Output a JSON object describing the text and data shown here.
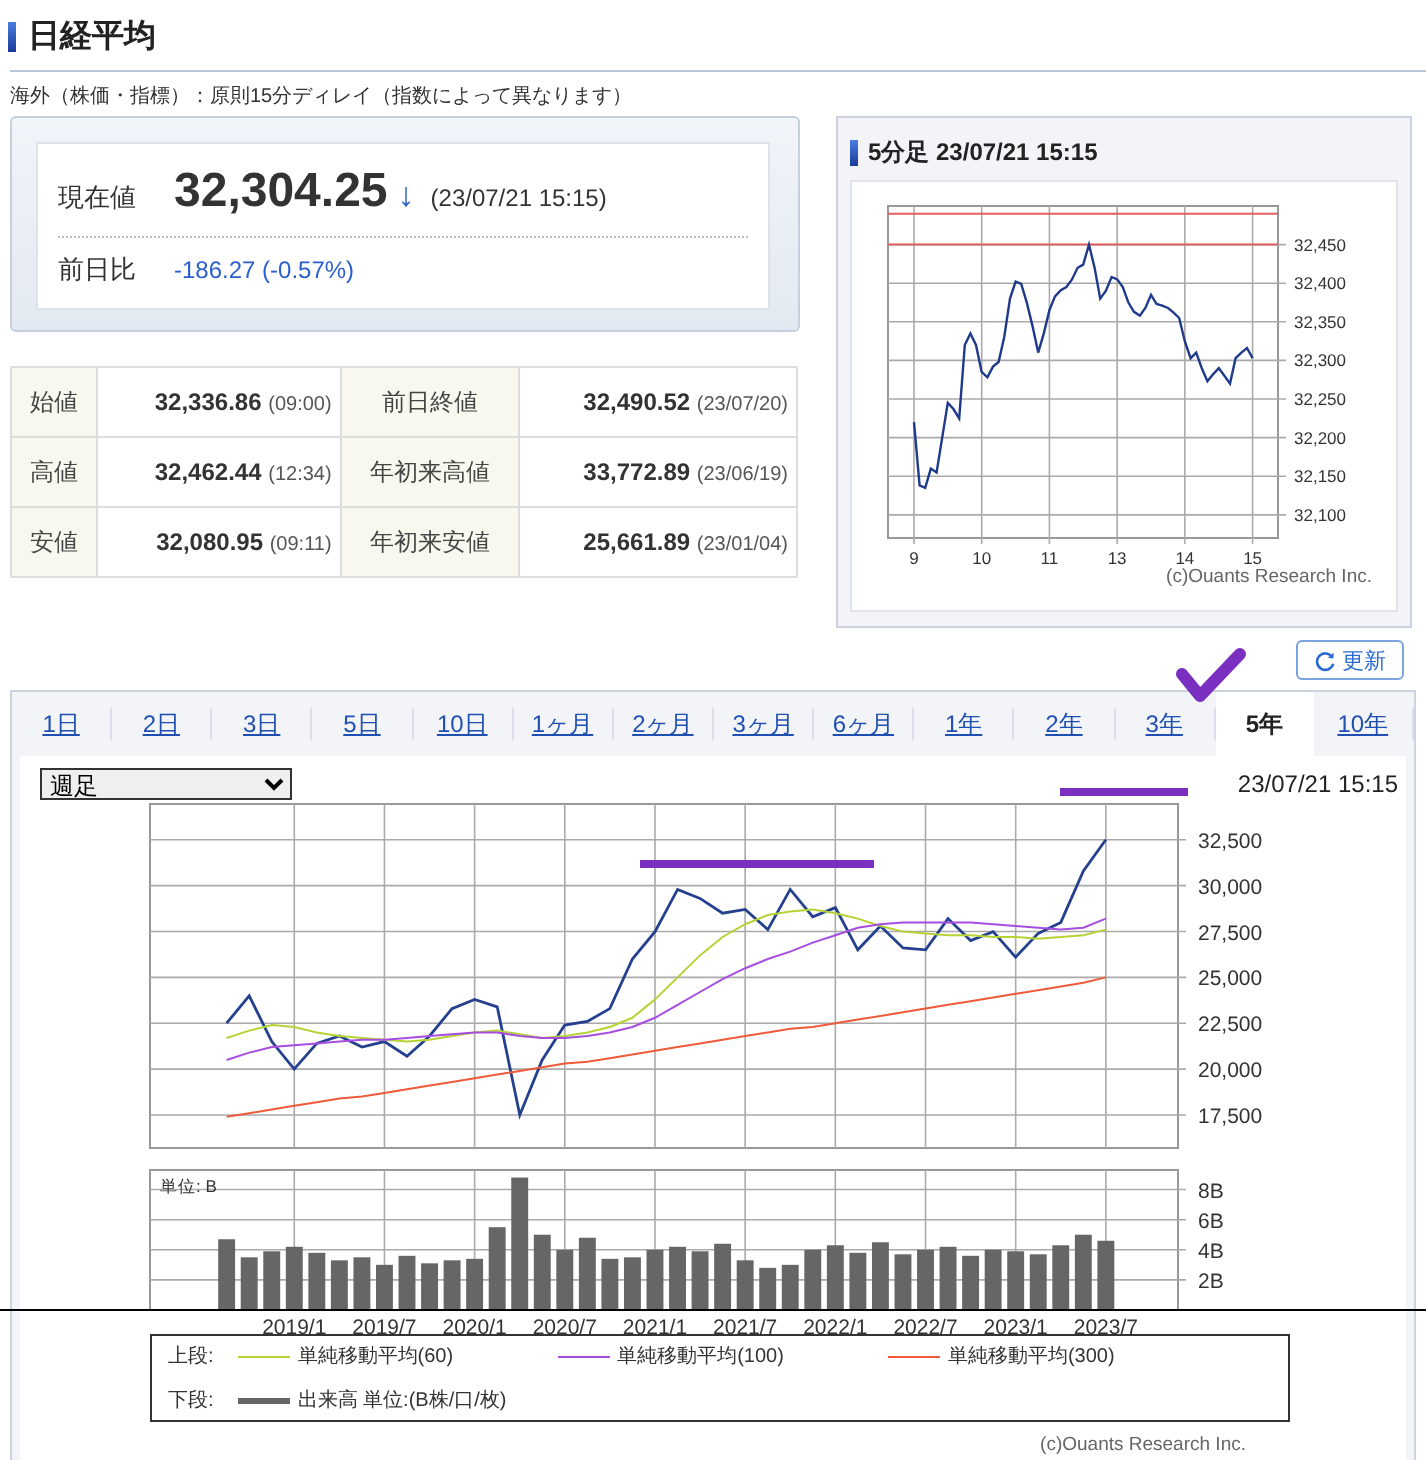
{
  "page_title": "日経平均",
  "note": "海外（株価・指標）：原則15分ディレイ（指数によって異なります）",
  "current": {
    "label": "現在値",
    "value": "32,304.25",
    "arrow": "↓",
    "time": "(23/07/21 15:15)",
    "change_label": "前日比",
    "change": "-186.27 (-0.57%)"
  },
  "stats": [
    {
      "cells": [
        {
          "label": "始値",
          "value": "32,336.86",
          "time": "(09:00)"
        },
        {
          "label": "前日終値",
          "value": "32,490.52",
          "time": "(23/07/20)"
        }
      ]
    },
    {
      "cells": [
        {
          "label": "高値",
          "value": "32,462.44",
          "time": "(12:34)"
        },
        {
          "label": "年初来高値",
          "value": "33,772.89",
          "time": "(23/06/19)"
        }
      ]
    },
    {
      "cells": [
        {
          "label": "安値",
          "value": "32,080.95",
          "time": "(09:11)"
        },
        {
          "label": "年初来安値",
          "value": "25,661.89",
          "time": "(23/01/04)"
        }
      ]
    }
  ],
  "intraday": {
    "title": "5分足 23/07/21 15:15",
    "credit": "(c)Ouants Research Inc.",
    "chart_data": {
      "type": "line",
      "categories": [
        "9",
        null,
        null,
        null,
        null,
        null,
        null,
        null,
        null,
        null,
        null,
        null,
        "10",
        null,
        null,
        null,
        null,
        null,
        null,
        null,
        null,
        null,
        null,
        null,
        "11",
        null,
        null,
        null,
        null,
        null,
        null,
        null,
        null,
        null,
        null,
        null,
        "13",
        null,
        null,
        null,
        null,
        null,
        null,
        null,
        null,
        null,
        null,
        null,
        "14",
        null,
        null,
        null,
        null,
        null,
        null,
        null,
        null,
        null,
        null,
        null,
        "15"
      ],
      "series": [
        {
          "color": "#1f3a8a",
          "values": [
            32220,
            32138,
            32135,
            32160,
            32155,
            32200,
            32245,
            32237,
            32225,
            32320,
            32335,
            32320,
            32285,
            32278,
            32292,
            32298,
            32330,
            32380,
            32402,
            32399,
            32375,
            32345,
            32310,
            32335,
            32365,
            32383,
            32391,
            32395,
            32405,
            32420,
            32424,
            32450,
            32420,
            32380,
            32390,
            32408,
            32405,
            32395,
            32375,
            32363,
            32358,
            32368,
            32385,
            32373,
            32371,
            32368,
            32362,
            32355,
            32325,
            32303,
            32310,
            32290,
            32273,
            32282,
            32290,
            32280,
            32270,
            32303,
            32310,
            32316,
            32303
          ]
        }
      ],
      "ylim": [
        32070,
        32500
      ],
      "grid": true,
      "ref_lines": [
        {
          "axis": "y",
          "value": 32490,
          "color": "#e06060"
        },
        {
          "axis": "y",
          "value": 32450,
          "color": "#e06060"
        }
      ],
      "yticks": [
        {
          "value": 32100,
          "label": "32,100"
        },
        {
          "value": 32150,
          "label": "32,150"
        },
        {
          "value": 32200,
          "label": "32,200"
        },
        {
          "value": 32250,
          "label": "32,250"
        },
        {
          "value": 32300,
          "label": "32,300"
        },
        {
          "value": 32350,
          "label": "32,350"
        },
        {
          "value": 32400,
          "label": "32,400"
        },
        {
          "value": 32450,
          "label": "32,450"
        }
      ]
    }
  },
  "refresh_button": "更新",
  "tabs": [
    {
      "label": "1日",
      "selected": false
    },
    {
      "label": "2日",
      "selected": false
    },
    {
      "label": "3日",
      "selected": false
    },
    {
      "label": "5日",
      "selected": false
    },
    {
      "label": "10日",
      "selected": false
    },
    {
      "label": "1ヶ月",
      "selected": false
    },
    {
      "label": "2ヶ月",
      "selected": false
    },
    {
      "label": "3ヶ月",
      "selected": false
    },
    {
      "label": "6ヶ月",
      "selected": false
    },
    {
      "label": "1年",
      "selected": false
    },
    {
      "label": "2年",
      "selected": false
    },
    {
      "label": "3年",
      "selected": false
    },
    {
      "label": "5年",
      "selected": true
    },
    {
      "label": "10年",
      "selected": false
    }
  ],
  "long_chart": {
    "period_select": "週足",
    "timestamp": "23/07/21 15:15",
    "chart_data": {
      "type": "line",
      "series": [
        {
          "color": "#24408e",
          "values": [
            22500,
            24000,
            21500,
            20000,
            21400,
            21800,
            21200,
            21500,
            20700,
            21800,
            23300,
            23800,
            23400,
            17500,
            20500,
            22400,
            22600,
            23300,
            26000,
            27500,
            29800,
            29300,
            28500,
            28700,
            27600,
            29800,
            28300,
            28800,
            26500,
            27800,
            26600,
            26500,
            28200,
            27000,
            27500,
            26100,
            27400,
            28000,
            30800,
            32500
          ]
        },
        {
          "name": "単純移動平均(60)",
          "color": "#b5d334",
          "values": [
            21700,
            22100,
            22400,
            22300,
            22000,
            21800,
            21700,
            21600,
            21500,
            21600,
            21800,
            22000,
            22100,
            21900,
            21700,
            21800,
            22000,
            22300,
            22800,
            23800,
            25000,
            26200,
            27200,
            27900,
            28400,
            28600,
            28700,
            28500,
            28200,
            27800,
            27500,
            27400,
            27300,
            27300,
            27200,
            27200,
            27100,
            27200,
            27300,
            27600
          ]
        },
        {
          "name": "単純移動平均(100)",
          "color": "#a64ee0",
          "values": [
            20500,
            20900,
            21200,
            21300,
            21400,
            21500,
            21600,
            21600,
            21700,
            21800,
            21900,
            22000,
            22000,
            21800,
            21700,
            21700,
            21800,
            22000,
            22300,
            22800,
            23500,
            24200,
            24900,
            25500,
            26000,
            26400,
            26900,
            27300,
            27700,
            27900,
            28000,
            28000,
            28000,
            28000,
            27900,
            27800,
            27700,
            27600,
            27700,
            28200
          ]
        },
        {
          "name": "単純移動平均(300)",
          "color": "#ef5a3a",
          "values": [
            17400,
            17600,
            17800,
            18000,
            18200,
            18400,
            18500,
            18700,
            18900,
            19100,
            19300,
            19500,
            19700,
            19900,
            20100,
            20300,
            20400,
            20600,
            20800,
            21000,
            21200,
            21400,
            21600,
            21800,
            22000,
            22200,
            22300,
            22500,
            22700,
            22900,
            23100,
            23300,
            23500,
            23700,
            23900,
            24100,
            24300,
            24500,
            24700,
            25000
          ]
        }
      ],
      "ylim": [
        15700,
        34450
      ],
      "grid": true,
      "yticks": [
        {
          "value": 17500,
          "label": "17,500"
        },
        {
          "value": 20000,
          "label": "20,000"
        },
        {
          "value": 22500,
          "label": "22,500"
        },
        {
          "value": 25000,
          "label": "25,000"
        },
        {
          "value": 27500,
          "label": "27,500"
        },
        {
          "value": 30000,
          "label": "30,000"
        },
        {
          "value": 32500,
          "label": "32,500"
        }
      ]
    },
    "volume": {
      "chart_data": {
        "type": "bar",
        "ylabel": "単位: B",
        "categories": [
          null,
          null,
          null,
          "2019/1",
          null,
          null,
          null,
          "2019/7",
          null,
          null,
          null,
          "2020/1",
          null,
          null,
          null,
          "2020/7",
          null,
          null,
          null,
          "2021/1",
          null,
          null,
          null,
          "2021/7",
          null,
          null,
          null,
          "2022/1",
          null,
          null,
          null,
          "2022/7",
          null,
          null,
          null,
          "2023/1",
          null,
          null,
          null,
          "2023/7"
        ],
        "series": [
          {
            "name": "出来高 単位:(B株/口/枚)",
            "color": "#666666",
            "values": [
              4.7,
              3.5,
              3.9,
              4.2,
              3.8,
              3.3,
              3.5,
              3.0,
              3.6,
              3.1,
              3.3,
              3.4,
              5.5,
              8.8,
              5.0,
              4.0,
              4.8,
              3.4,
              3.5,
              4.0,
              4.2,
              3.9,
              4.4,
              3.3,
              2.8,
              3.0,
              4.0,
              4.3,
              3.8,
              4.5,
              3.7,
              4.0,
              4.2,
              3.6,
              4.0,
              3.9,
              3.7,
              4.3,
              5.0,
              4.6
            ]
          }
        ],
        "ylim": [
          0,
          9.3
        ],
        "grid": true,
        "yticks": [
          {
            "value": 2,
            "label": "2B"
          },
          {
            "value": 4,
            "label": "4B"
          },
          {
            "value": 6,
            "label": "6B"
          },
          {
            "value": 8,
            "label": "8B"
          }
        ]
      }
    },
    "legend": {
      "upper_label": "上段:",
      "lower_label": "下段:"
    },
    "credit": "(c)Ouants Research Inc."
  }
}
